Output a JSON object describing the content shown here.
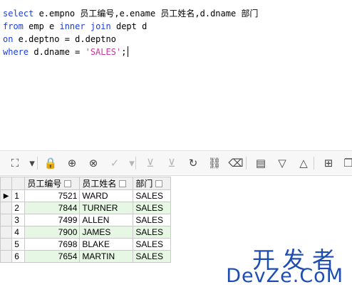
{
  "editor": {
    "line1": {
      "kw": "select",
      "rest": " e.empno 员工编号,e.ename 员工姓名,d.dname 部门"
    },
    "line2": {
      "kw1": "from",
      "mid1": " emp e ",
      "kw2": "inner",
      "sp": " ",
      "kw3": "join",
      "rest": " dept d"
    },
    "line3": {
      "kw": "on",
      "rest": " e.deptno = d.deptno"
    },
    "line4": {
      "kw": "where",
      "mid": " d.dname = ",
      "str": "'SALES'",
      "end": ";"
    }
  },
  "toolbar": {
    "buttons": [
      {
        "name": "grid-options-icon",
        "glyph": "⛶",
        "enabled": true
      },
      {
        "name": "dropdown-arrow-icon",
        "glyph": "▾",
        "enabled": true
      },
      {
        "name": "lock-icon",
        "glyph": "🔒",
        "enabled": true
      },
      {
        "name": "add-row-icon",
        "glyph": "⊕",
        "enabled": true
      },
      {
        "name": "delete-row-icon",
        "glyph": "⊗",
        "enabled": true
      },
      {
        "name": "apply-icon",
        "glyph": "✓",
        "enabled": false
      },
      {
        "name": "apply-dropdown-icon",
        "glyph": "▾",
        "enabled": false
      },
      {
        "name": "download-icon",
        "glyph": "⊻",
        "enabled": false
      },
      {
        "name": "download-all-icon",
        "glyph": "⊻",
        "enabled": false
      },
      {
        "name": "refresh-icon",
        "glyph": "↻",
        "enabled": true
      },
      {
        "name": "binoculars-icon",
        "glyph": "⛓",
        "enabled": true
      },
      {
        "name": "eraser-icon",
        "glyph": "⌫",
        "enabled": true
      },
      {
        "name": "table-view-icon",
        "glyph": "▤",
        "enabled": true
      },
      {
        "name": "sort-desc-icon",
        "glyph": "▽",
        "enabled": true
      },
      {
        "name": "sort-asc-icon",
        "glyph": "△",
        "enabled": true
      },
      {
        "name": "tree-view-icon",
        "glyph": "⊞",
        "enabled": true
      },
      {
        "name": "copy-icon",
        "glyph": "❐",
        "enabled": true
      }
    ]
  },
  "grid": {
    "columns": [
      "员工编号",
      "员工姓名",
      "部门"
    ],
    "rows": [
      {
        "num": "1",
        "empno": "7521",
        "ename": "WARD",
        "dname": "SALES"
      },
      {
        "num": "2",
        "empno": "7844",
        "ename": "TURNER",
        "dname": "SALES"
      },
      {
        "num": "3",
        "empno": "7499",
        "ename": "ALLEN",
        "dname": "SALES"
      },
      {
        "num": "4",
        "empno": "7900",
        "ename": "JAMES",
        "dname": "SALES"
      },
      {
        "num": "5",
        "empno": "7698",
        "ename": "BLAKE",
        "dname": "SALES"
      },
      {
        "num": "6",
        "empno": "7654",
        "ename": "MARTIN",
        "dname": "SALES"
      }
    ],
    "current_row_marker": "▶"
  },
  "watermark": {
    "line1": "开发者",
    "line2": "DevZe.CoM"
  }
}
